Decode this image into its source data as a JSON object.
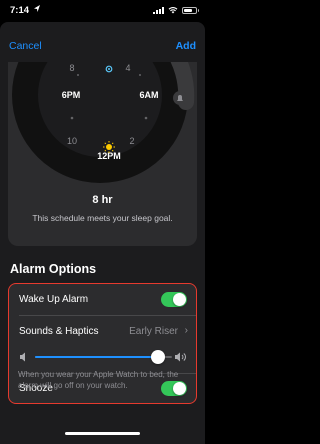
{
  "status_bar": {
    "time": "7:14"
  },
  "nav": {
    "cancel_label": "Cancel",
    "add_label": "Add"
  },
  "clock": {
    "hour_labels": {
      "6pm": "6PM",
      "6am": "6AM",
      "12pm": "12PM"
    },
    "numbers": [
      "8",
      "4",
      "10",
      "2",
      "8",
      "4",
      "10",
      "2"
    ],
    "duration": "8 hr",
    "goal_text": "This schedule meets your sleep goal."
  },
  "alarm_options": {
    "title": "Alarm Options",
    "wake_up_label": "Wake Up Alarm",
    "wake_up_on": true,
    "sounds_label": "Sounds & Haptics",
    "sounds_value": "Early Riser",
    "volume_level": 0.9,
    "snooze_label": "Snooze",
    "snooze_on": true
  },
  "footer_note": "When you wear your Apple Watch to bed, the alarm will go off on your watch.",
  "colors": {
    "accent": "#1e90ff",
    "toggle_on": "#34c759",
    "highlight_border": "#e63a2e"
  }
}
